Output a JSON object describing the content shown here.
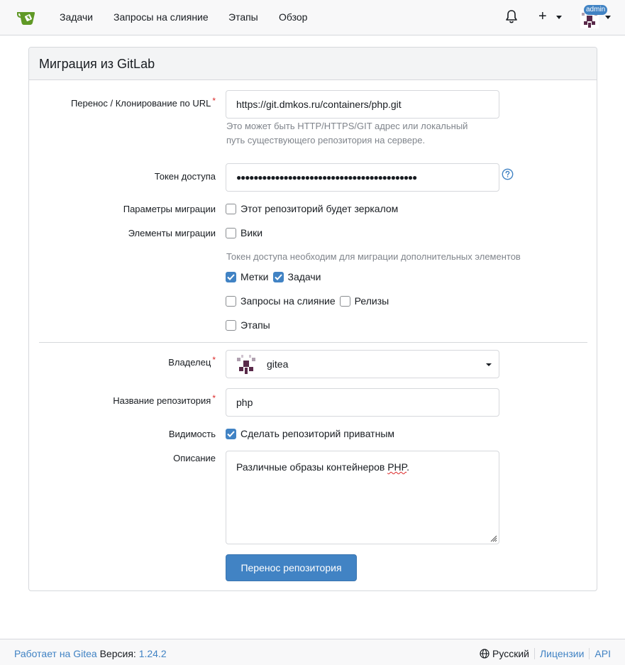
{
  "nav": {
    "items": [
      "Задачи",
      "Запросы на слияние",
      "Этапы",
      "Обзор"
    ],
    "admin_badge": "admin",
    "icons": {
      "logo": "gitea-teacup-logo",
      "bell": "bell-icon",
      "plus": "plus-icon",
      "avatar": "user-avatar"
    }
  },
  "form": {
    "title": "Миграция из GitLab",
    "url_label": "Перенос / Клонирование по URL",
    "url_value": "https://git.dmkos.ru/containers/php.git",
    "url_help": "Это может быть HTTP/HTTPS/GIT адрес или локальный путь существующего репозитория на сервере.",
    "token_label": "Токен доступа",
    "token_value": "●●●●●●●●●●●●●●●●●●●●●●●●●●●●●●●●●●●●●●●●●●",
    "params_label": "Параметры миграции",
    "mirror_label": "Этот репозиторий будет зеркалом",
    "items_label": "Элементы миграции",
    "wiki_label": "Вики",
    "items_help": "Токен доступа необходим для миграции дополнительных элементов",
    "labels_label": "Метки",
    "issues_label": "Задачи",
    "pulls_label": "Запросы на слияние",
    "releases_label": "Релизы",
    "milestones_label": "Этапы",
    "owner_label": "Владелец",
    "owner_value": "gitea",
    "repo_name_label": "Название репозитория",
    "repo_name_value": "php",
    "visibility_label": "Видимость",
    "private_label": "Сделать репозиторий приватным",
    "description_label": "Описание",
    "description_before": "Различные образы контейнеров ",
    "description_misspelled": "PHP",
    "description_after": ".",
    "submit_label": "Перенос репозитория",
    "checked": {
      "mirror": false,
      "wiki": false,
      "labels": true,
      "issues": true,
      "pulls": false,
      "releases": false,
      "milestones": false,
      "private": true
    }
  },
  "footer": {
    "powered_by": "Работает на Gitea",
    "version_label": "Версия:",
    "version": "1.24.2",
    "language": "Русский",
    "licenses": "Лицензии",
    "api": "API"
  },
  "colors": {
    "primary": "#4183c4",
    "required": "#db2828",
    "muted": "#80858c"
  }
}
